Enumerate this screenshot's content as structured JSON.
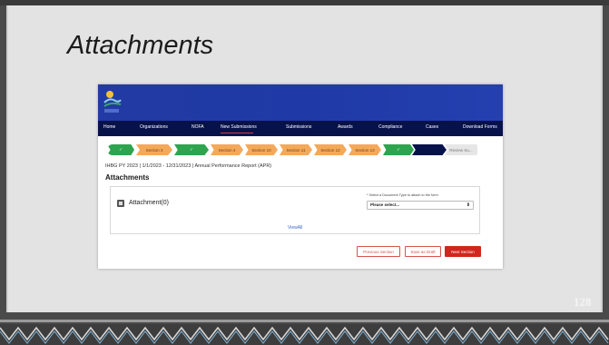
{
  "slide": {
    "title": "Attachments",
    "page_number": "128"
  },
  "app": {
    "nav": [
      {
        "label": "Home"
      },
      {
        "label": "Organizations"
      },
      {
        "label": "NOFA"
      },
      {
        "label": "New Submissions",
        "active": true
      },
      {
        "label": "Submissions"
      },
      {
        "label": "Awards"
      },
      {
        "label": "Compliance"
      },
      {
        "label": "Cases"
      },
      {
        "label": "Download Forms"
      }
    ],
    "stepper": [
      {
        "label": "✓",
        "state": "complete"
      },
      {
        "label": "Section 3",
        "state": "incomplete"
      },
      {
        "label": "✓",
        "state": "complete"
      },
      {
        "label": "Section 4",
        "state": "incomplete"
      },
      {
        "label": "Section 10",
        "state": "incomplete"
      },
      {
        "label": "Section 11",
        "state": "incomplete"
      },
      {
        "label": "Section 12",
        "state": "incomplete"
      },
      {
        "label": "Section 13",
        "state": "incomplete"
      },
      {
        "label": "✓",
        "state": "complete"
      },
      {
        "label": "",
        "state": "current"
      },
      {
        "label": "Review Su...",
        "state": "pending"
      }
    ],
    "breadcrumb": "IHBG PY 2023 | 1/1/2023 - 12/31/2023 | Annual Performance Report (APR)",
    "section_heading": "Attachments",
    "attachment_label": "Attachment(0)",
    "document_type_label": "* Select a Document Type to attach to the form",
    "document_type_select": "Please select...",
    "view_all": "ViewAll",
    "buttons": {
      "previous": "Previous Section",
      "save_draft": "Save as Draft",
      "next": "Next Section"
    }
  },
  "colors": {
    "banner": "#223aa3",
    "nav_bg": "#08124a",
    "step_complete": "#2ea44f",
    "step_incomplete": "#f3a95a",
    "step_current": "#08124a",
    "step_pending": "#e6e6e6",
    "primary_button": "#d0261d"
  }
}
